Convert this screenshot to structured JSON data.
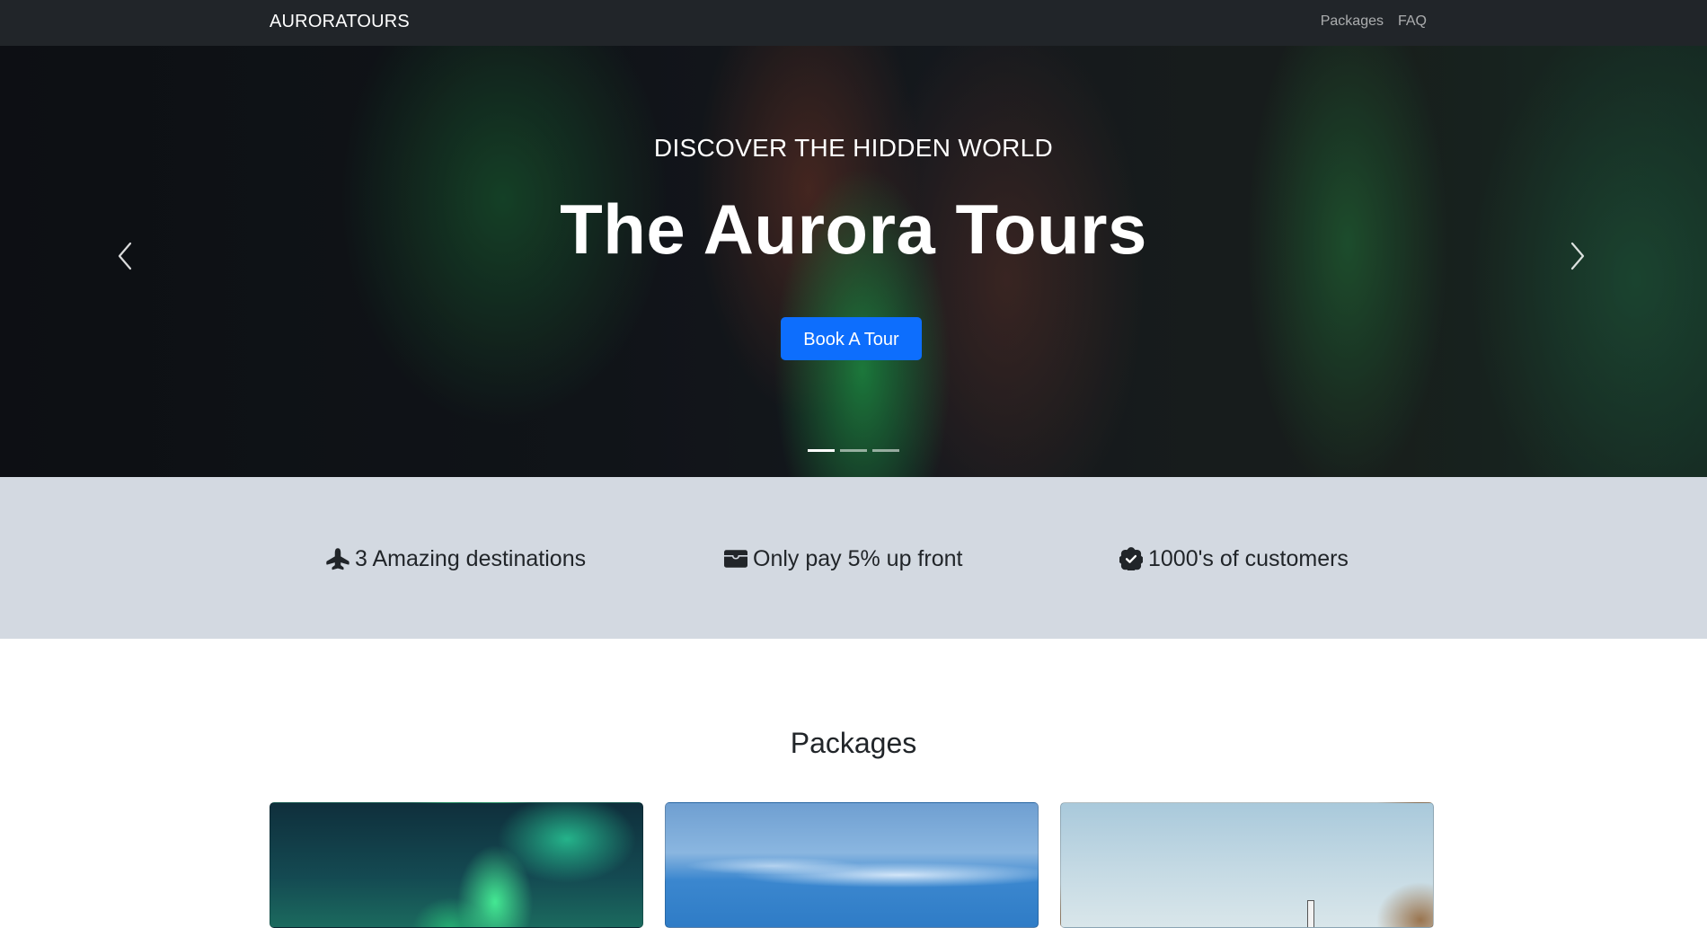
{
  "navbar": {
    "brand": "AURORATOURS",
    "links": [
      "Packages",
      "FAQ"
    ]
  },
  "hero": {
    "subtitle": "DISCOVER THE HIDDEN WORLD",
    "title": "The Aurora Tours",
    "button_label": "Book A Tour",
    "slide_count": 3,
    "active_slide": 1,
    "prev_icon": "chevron-left-icon",
    "next_icon": "chevron-right-icon"
  },
  "features": [
    {
      "icon": "airplane-icon",
      "text": "3 Amazing destinations"
    },
    {
      "icon": "wallet-icon",
      "text": "Only pay 5% up front"
    },
    {
      "icon": "patch-check-icon",
      "text": "1000's of customers"
    }
  ],
  "packages": {
    "title": "Packages"
  },
  "colors": {
    "navbar_bg": "#212529",
    "primary": "#0d6efd",
    "features_bg": "#d3d9e1"
  }
}
